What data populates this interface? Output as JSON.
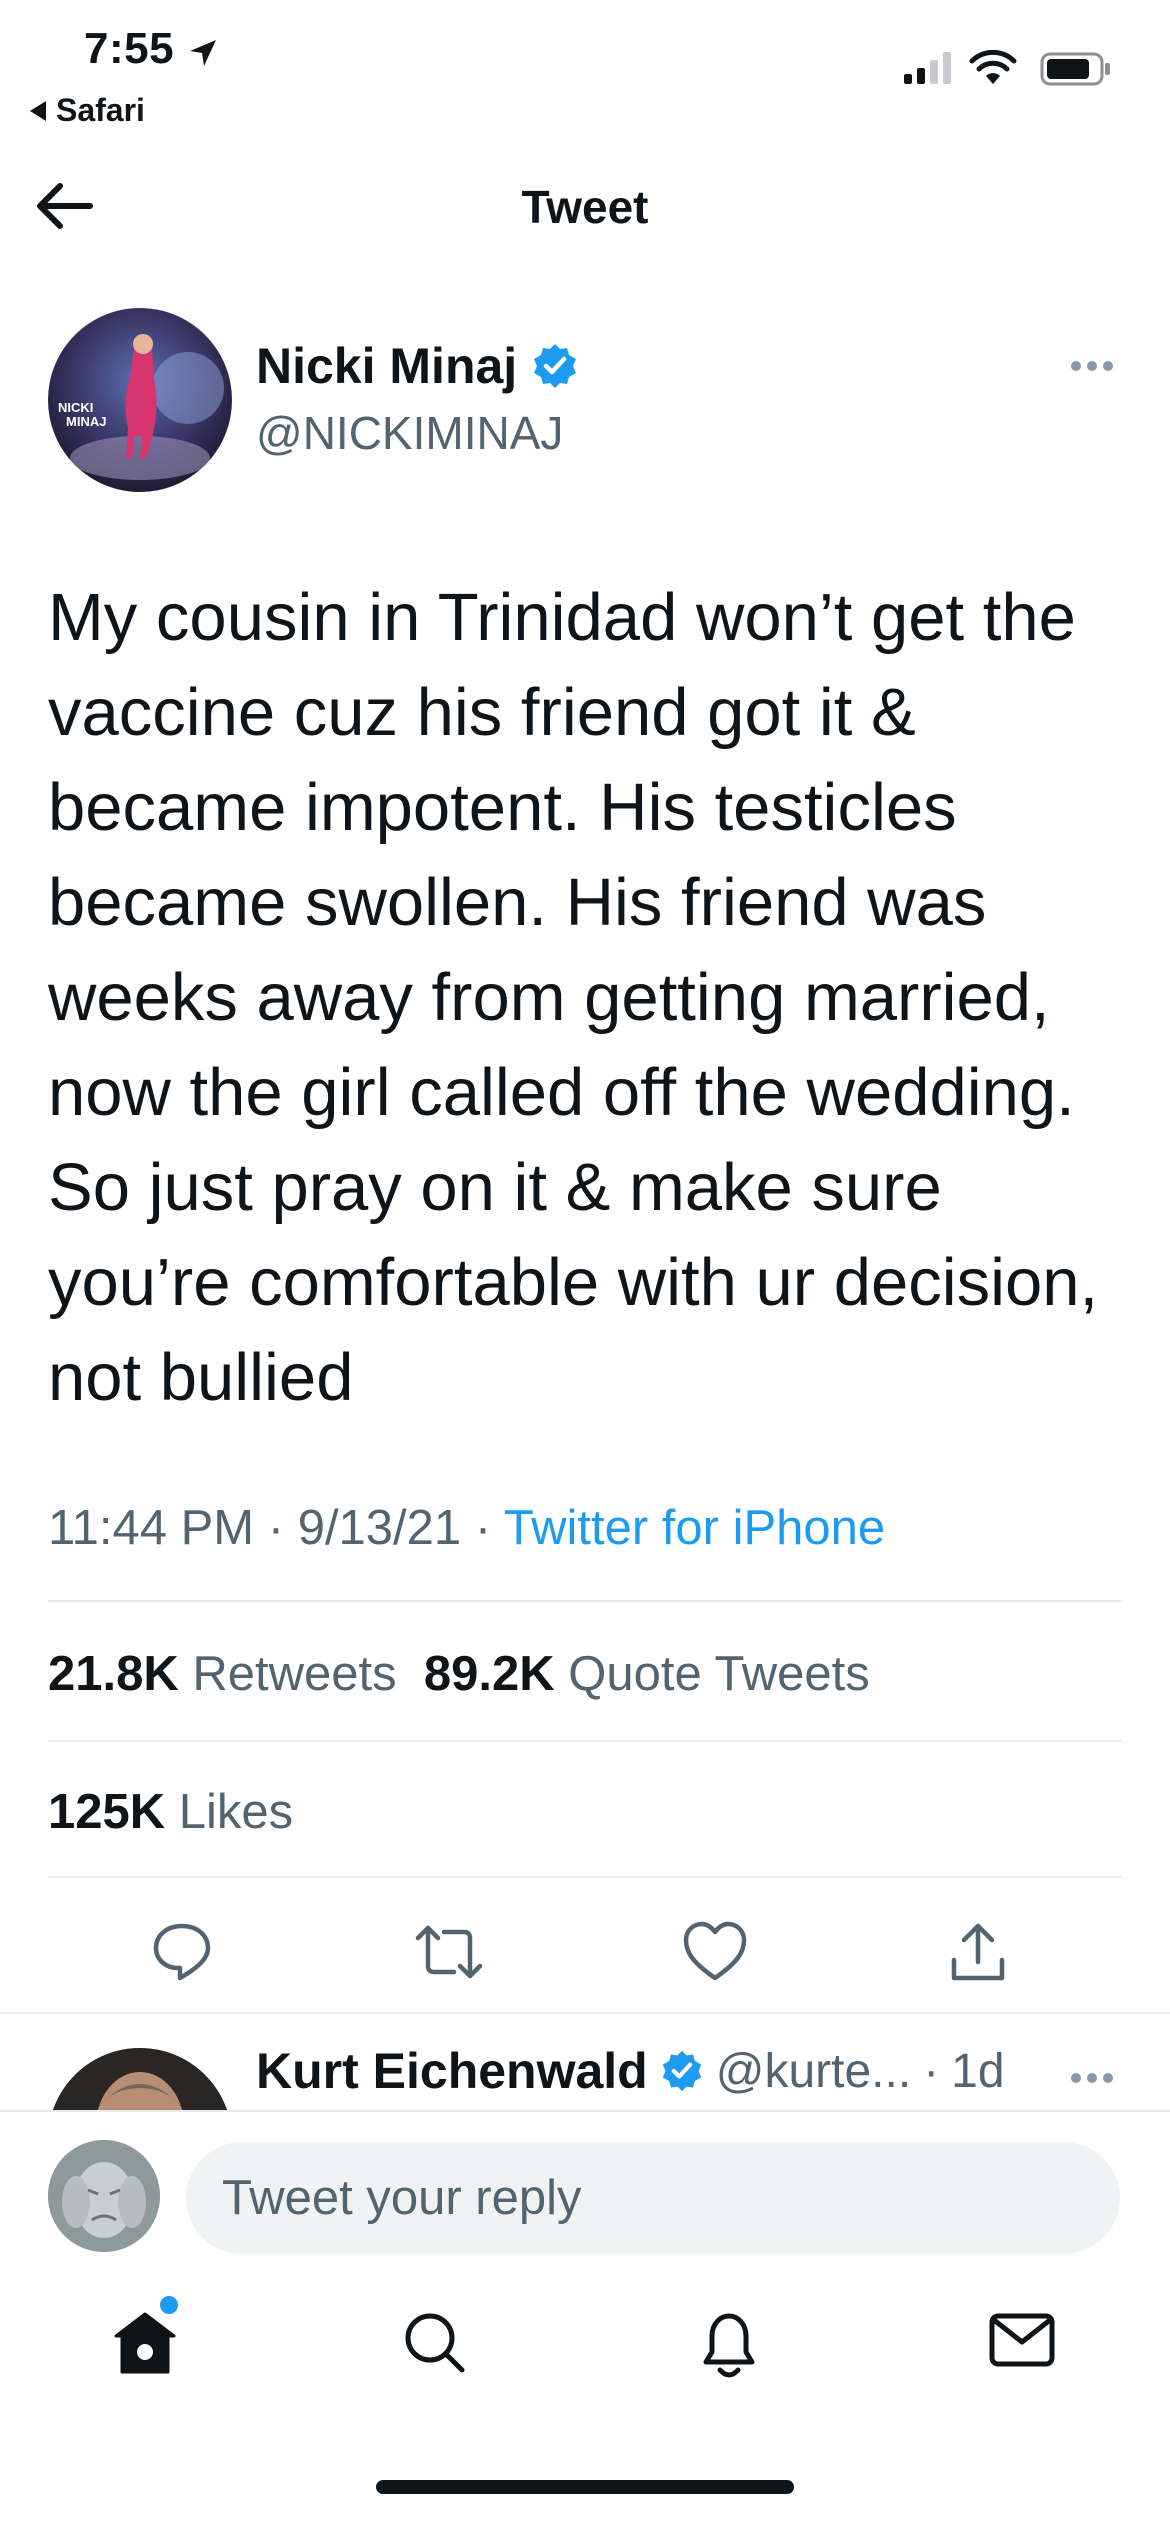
{
  "status_bar": {
    "time": "7:55",
    "back_app": "Safari"
  },
  "header": {
    "title": "Tweet"
  },
  "tweet": {
    "author_name": "Nicki Minaj",
    "author_handle": "@NICKIMINAJ",
    "avatar_text_1": "NICKI",
    "avatar_text_2": "MINAJ",
    "text": "My cousin in Trinidad won’t get the vaccine cuz his friend got it & became impotent. His testicles became swollen. His friend was weeks away from getting married, now the girl called off the wedding. So just pray on it & make sure you’re comfortable with ur decision, not bullied",
    "time": "11:44 PM",
    "date": "9/13/21",
    "source": "Twitter for iPhone",
    "separator": "·"
  },
  "stats": {
    "retweets_count": "21.8K",
    "retweets_label": "Retweets",
    "quotes_count": "89.2K",
    "quotes_label": "Quote Tweets",
    "likes_count": "125K",
    "likes_label": "Likes"
  },
  "reply_preview": {
    "author_name": "Kurt Eichenwald",
    "handle": "@kurte...",
    "separator": "·",
    "age": "1d"
  },
  "composer": {
    "placeholder": "Tweet your reply"
  },
  "colors": {
    "accent": "#1d9bf0",
    "text": "#0f1419",
    "secondary": "#536471",
    "divider": "#e6ecf0"
  },
  "icons": {
    "actions": [
      "reply-icon",
      "retweet-icon",
      "like-icon",
      "share-icon"
    ],
    "tabs": [
      "home-icon",
      "search-icon",
      "notifications-icon",
      "messages-icon"
    ]
  }
}
